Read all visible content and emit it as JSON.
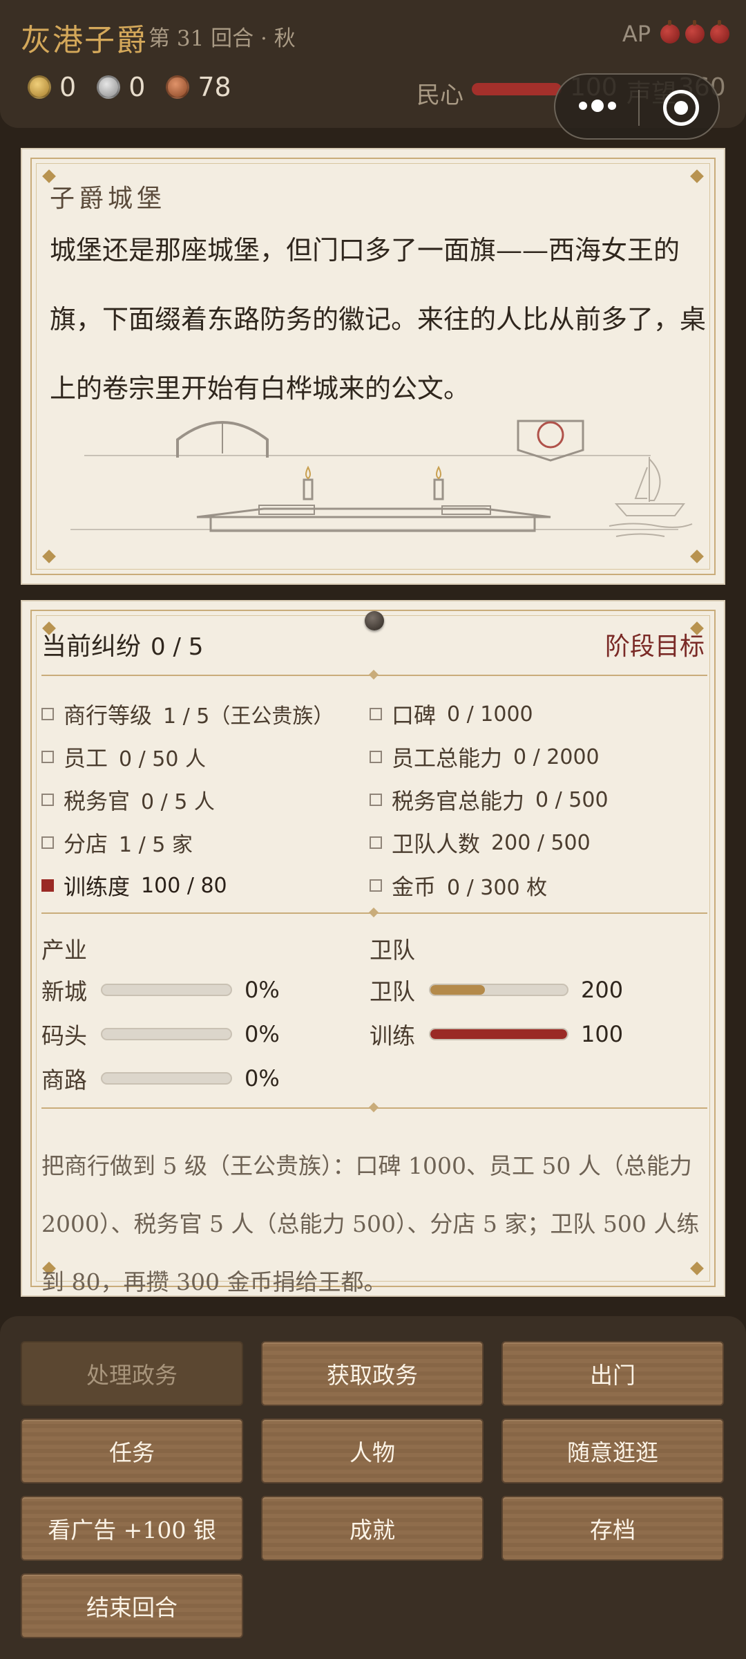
{
  "header": {
    "title": "灰港子爵",
    "turn": "第 31 回合 · 秋",
    "ap_label": "AP",
    "ap_count": 3,
    "gold": "0",
    "silver": "0",
    "copper": "78",
    "minxin_label": "民心",
    "minxin_value": "100",
    "minxin_fraction": 1.0,
    "reputation_label": "声望",
    "reputation_value": "360"
  },
  "story": {
    "title": "子爵城堡",
    "text": "城堡还是那座城堡，但门口多了一面旗——西海女王的旗，下面缀着东路防务的徽记。来往的人比从前多了，桌上的卷宗里开始有白桦城来的公文。"
  },
  "stats": {
    "dispute_label": "当前纠纷",
    "dispute_value": "0 / 5",
    "goal_link": "阶段目标",
    "requirements": [
      {
        "label": "商行等级",
        "value": "1 / 5（王公贵族）",
        "done": false
      },
      {
        "label": "口碑",
        "value": "0 / 1000",
        "done": false
      },
      {
        "label": "员工",
        "value": "0 / 50 人",
        "done": false
      },
      {
        "label": "员工总能力",
        "value": "0 / 2000",
        "done": false
      },
      {
        "label": "税务官",
        "value": "0 / 5 人",
        "done": false
      },
      {
        "label": "税务官总能力",
        "value": "0 / 500",
        "done": false
      },
      {
        "label": "分店",
        "value": "1 / 5 家",
        "done": false
      },
      {
        "label": "卫队人数",
        "value": "200 / 500",
        "done": false
      },
      {
        "label": "训练度",
        "value": "100 / 80",
        "done": true
      },
      {
        "label": "金币",
        "value": "0 / 300 枚",
        "done": false
      }
    ],
    "industry_title": "产业",
    "industry": [
      {
        "label": "新城",
        "value": "0%",
        "fraction": 0
      },
      {
        "label": "码头",
        "value": "0%",
        "fraction": 0
      },
      {
        "label": "商路",
        "value": "0%",
        "fraction": 0
      }
    ],
    "guard_title": "卫队",
    "guard": [
      {
        "label": "卫队",
        "value": "200",
        "fraction": 0.4
      },
      {
        "label": "训练",
        "value": "100",
        "fraction": 1.0
      }
    ],
    "goal_text": "把商行做到 5 级（王公贵族）：口碑 1000、员工 50 人（总能力 2000）、税务官 5 人（总能力 500）、分店 5 家；卫队 500 人练到 80，再攒 300 金币捐给王都。"
  },
  "actions": [
    {
      "label": "处理政务",
      "disabled": true
    },
    {
      "label": "获取政务",
      "disabled": false
    },
    {
      "label": "出门",
      "disabled": false
    },
    {
      "label": "任务",
      "disabled": false
    },
    {
      "label": "人物",
      "disabled": false
    },
    {
      "label": "随意逛逛",
      "disabled": false
    },
    {
      "label": "看广告 +100 银",
      "disabled": false
    },
    {
      "label": "成就",
      "disabled": false
    },
    {
      "label": "存档",
      "disabled": false
    },
    {
      "label": "结束回合",
      "disabled": false
    }
  ],
  "colors": {
    "accent_gold": "#d4a85a",
    "danger_red": "#9a2a25",
    "parchment": "#f3ede1",
    "wood_button": "#8f6d4c"
  }
}
